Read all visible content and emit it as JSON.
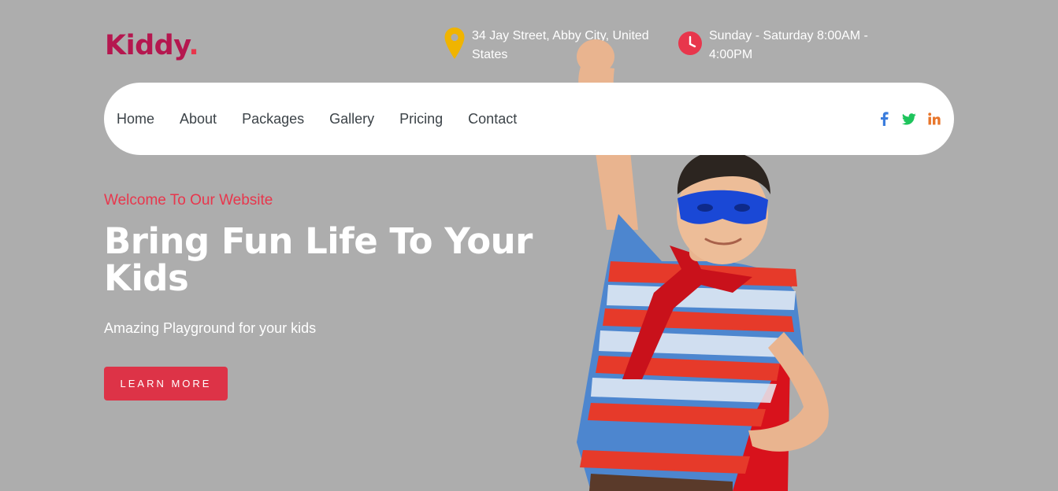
{
  "brand": {
    "name": "Kiddy",
    "dot": ".",
    "color": "#b5174f"
  },
  "header": {
    "address": {
      "icon": "map-pin-icon",
      "text": "34 Jay Street, Abby City, United States"
    },
    "hours": {
      "icon": "clock-icon",
      "text": "Sunday - Saturday 8:00AM - 4:00PM"
    }
  },
  "nav": {
    "items": [
      {
        "label": "Home"
      },
      {
        "label": "About"
      },
      {
        "label": "Packages"
      },
      {
        "label": "Gallery"
      },
      {
        "label": "Pricing"
      },
      {
        "label": "Contact"
      }
    ],
    "social": [
      {
        "icon": "facebook-icon",
        "color": "#3b7ddd"
      },
      {
        "icon": "twitter-icon",
        "color": "#1ec45c"
      },
      {
        "icon": "linkedin-icon",
        "color": "#e8762b"
      }
    ]
  },
  "hero": {
    "welcome": "Welcome To Our Website",
    "headline": "Bring Fun Life To Your Kids",
    "subtitle": "Amazing Playground for your kids",
    "cta": "LEARN MORE",
    "accent": "#dd3347",
    "background": "#adadad"
  }
}
